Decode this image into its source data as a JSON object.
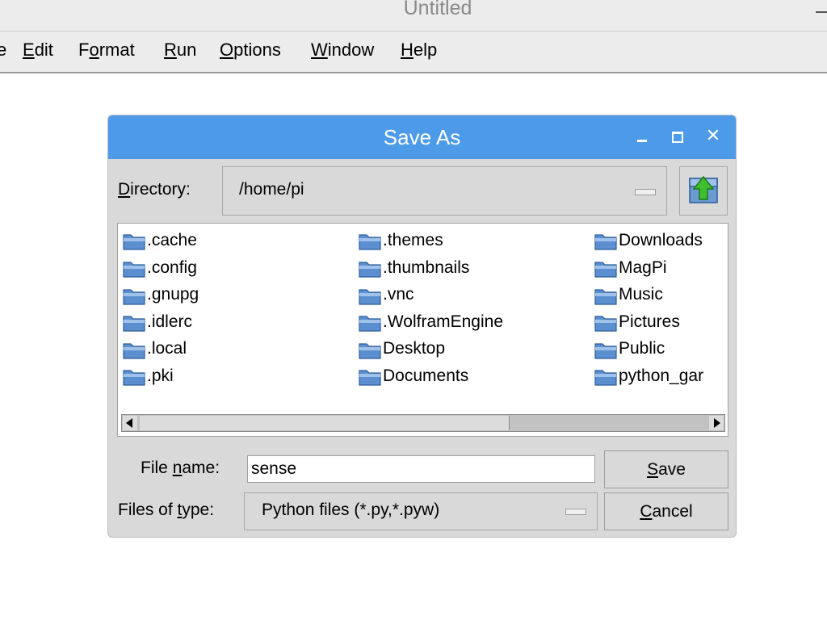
{
  "window": {
    "title": "Untitled"
  },
  "menubar": {
    "items": [
      {
        "label": "e",
        "mnemonic": ""
      },
      {
        "label": "Edit",
        "mnemonic": "E"
      },
      {
        "label": "Format",
        "mnemonic": "o"
      },
      {
        "label": "Run",
        "mnemonic": "R"
      },
      {
        "label": "Options",
        "mnemonic": "O"
      },
      {
        "label": "Window",
        "mnemonic": "W"
      },
      {
        "label": "Help",
        "mnemonic": "H"
      }
    ]
  },
  "dialog": {
    "title": "Save As",
    "directory_label": "Directory:",
    "directory_value": "/home/pi",
    "up_button_icon": "folder-up-arrow-icon",
    "columns": [
      [
        ".cache",
        ".config",
        ".gnupg",
        ".idlerc",
        ".local",
        ".pki"
      ],
      [
        ".themes",
        ".thumbnails",
        ".vnc",
        ".WolframEngine",
        "Desktop",
        "Documents"
      ],
      [
        "Downloads",
        "MagPi",
        "Music",
        "Pictures",
        "Public",
        "python_gar"
      ]
    ],
    "filename_label": "File name:",
    "filename_value": "sense",
    "filetype_label": "Files of type:",
    "filetype_value": "Python files (*.py,*.pyw)",
    "save_label": "Save",
    "cancel_label": "Cancel"
  },
  "colors": {
    "dialog_titlebar": "#4d9be8",
    "folder_blue": "#5b8fd0"
  }
}
